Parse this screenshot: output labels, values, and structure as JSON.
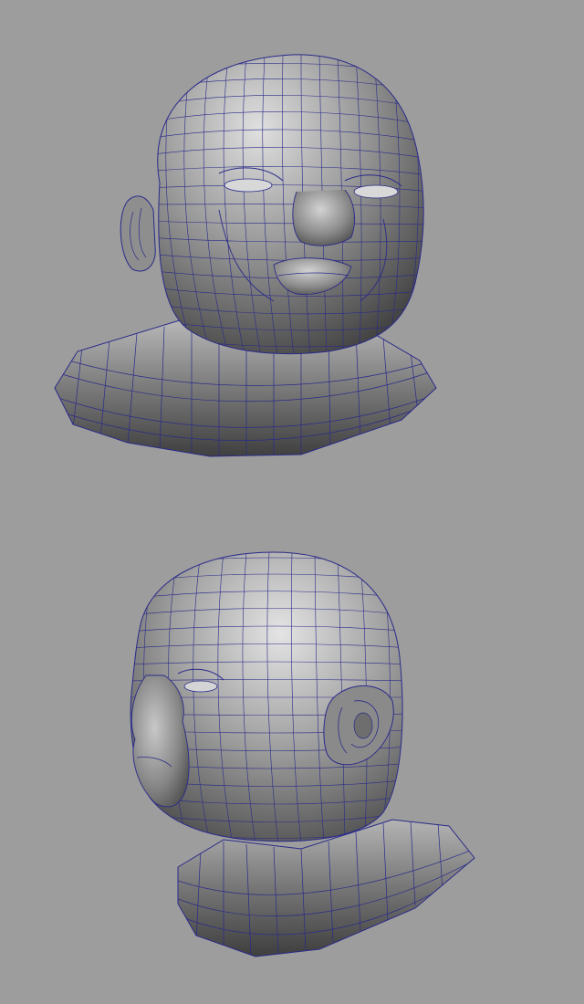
{
  "viewport": {
    "background_color": "#9d9d9d",
    "wire_color": "#2a2a8a",
    "surface_light": "#d8d8d8",
    "surface_dark": "#3e3e3e"
  },
  "views": [
    {
      "name": "front-three-quarter",
      "subject": "baby-head-wireframe"
    },
    {
      "name": "side-three-quarter",
      "subject": "baby-head-wireframe"
    }
  ]
}
